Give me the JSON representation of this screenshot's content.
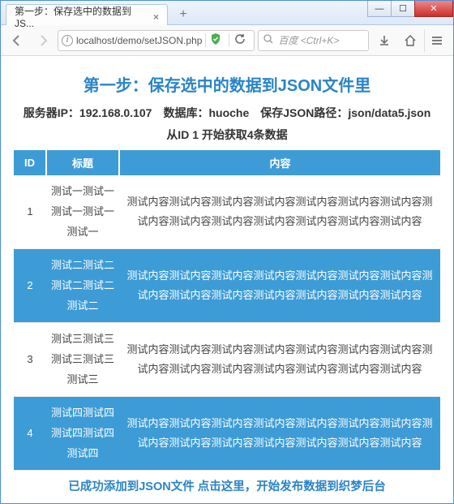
{
  "window": {
    "tab_title": "第一步：保存选中的数据到JS...",
    "url": "localhost/demo/setJSON.php",
    "search_placeholder": "百度 <Ctrl+K>"
  },
  "page": {
    "title": "第一步：保存选中的数据到JSON文件里",
    "info_line": "服务器IP：192.168.0.107　数据库：huoche　保存JSON路径：json/data5.json　　从ID 1 开始获取4条数据",
    "footer": "已成功添加到JSON文件 点击这里，开始发布数据到织梦后台"
  },
  "table": {
    "headers": {
      "id": "ID",
      "title": "标题",
      "content": "内容"
    },
    "rows": [
      {
        "id": "1",
        "title": "测试一测试一测试一测试一测试一",
        "content": "测试内容测试内容测试内容测试内容测试内容测试内容测试内容测试内容测试内容测试内容测试内容测试内容测试内容测试内容"
      },
      {
        "id": "2",
        "title": "测试二测试二测试二测试二测试二",
        "content": "测试内容测试内容测试内容测试内容测试内容测试内容测试内容测试内容测试内容测试内容测试内容测试内容测试内容测试内容"
      },
      {
        "id": "3",
        "title": "测试三测试三测试三测试三测试三",
        "content": "测试内容测试内容测试内容测试内容测试内容测试内容测试内容测试内容测试内容测试内容测试内容测试内容测试内容测试内容"
      },
      {
        "id": "4",
        "title": "测试四测试四测试四测试四测试四",
        "content": "测试内容测试内容测试内容测试内容测试内容测试内容测试内容测试内容测试内容测试内容测试内容测试内容测试内容测试内容"
      }
    ]
  }
}
